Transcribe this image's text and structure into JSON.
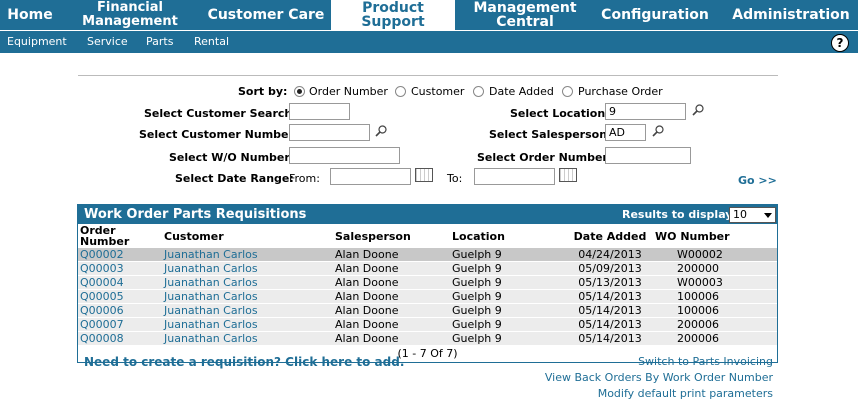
{
  "nav": {
    "items": [
      {
        "label": "Home"
      },
      {
        "label": "Financial Management"
      },
      {
        "label": "Customer Care"
      },
      {
        "label": "Product Support"
      },
      {
        "label": "Management Central"
      },
      {
        "label": "Configuration"
      },
      {
        "label": "Administration"
      }
    ],
    "active": "Product Support"
  },
  "subnav": {
    "items": [
      "Equipment",
      "Service",
      "Parts",
      "Rental"
    ],
    "help": "?"
  },
  "search": {
    "sort_by_label": "Sort by:",
    "sort_options": [
      "Order Number",
      "Customer",
      "Date Added",
      "Purchase Order"
    ],
    "sort_selected": "Order Number",
    "customer_search_label": "Select Customer Search:",
    "customer_search_value": "",
    "location_label": "Select Location:",
    "location_value": "9",
    "customer_number_label": "Select Customer Number:",
    "customer_number_value": "",
    "salesperson_label": "Select Salesperson:",
    "salesperson_value": "AD",
    "wo_number_label": "Select W/O Number:",
    "wo_number_value": "",
    "order_number_label": "Select Order Number:",
    "order_number_value": "",
    "date_range_label": "Select Date Range:",
    "from_label": "From:",
    "from_value": "",
    "to_label": "To:",
    "to_value": "",
    "go": "Go >>"
  },
  "grid": {
    "title": "Work Order Parts Requisitions",
    "results_label": "Results to display:",
    "results_value": "10",
    "columns": [
      "Order Number",
      "Customer",
      "Salesperson",
      "Location",
      "Date Added",
      "WO Number"
    ],
    "rows": [
      {
        "order": "Q00002",
        "customer": "Juanathan Carlos",
        "salesperson": "Alan Doone",
        "location": "Guelph 9",
        "date": "04/24/2013",
        "wo": "W00002"
      },
      {
        "order": "Q00003",
        "customer": "Juanathan Carlos",
        "salesperson": "Alan Doone",
        "location": "Guelph 9",
        "date": "05/09/2013",
        "wo": "200000"
      },
      {
        "order": "Q00004",
        "customer": "Juanathan Carlos",
        "salesperson": "Alan Doone",
        "location": "Guelph 9",
        "date": "05/13/2013",
        "wo": "W00003"
      },
      {
        "order": "Q00005",
        "customer": "Juanathan Carlos",
        "salesperson": "Alan Doone",
        "location": "Guelph 9",
        "date": "05/14/2013",
        "wo": "100006"
      },
      {
        "order": "Q00006",
        "customer": "Juanathan Carlos",
        "salesperson": "Alan Doone",
        "location": "Guelph 9",
        "date": "05/14/2013",
        "wo": "100006"
      },
      {
        "order": "Q00007",
        "customer": "Juanathan Carlos",
        "salesperson": "Alan Doone",
        "location": "Guelph 9",
        "date": "05/14/2013",
        "wo": "200006"
      },
      {
        "order": "Q00008",
        "customer": "Juanathan Carlos",
        "salesperson": "Alan Doone",
        "location": "Guelph 9",
        "date": "05/14/2013",
        "wo": "200006"
      }
    ],
    "pager": "(1 - 7 Of 7)"
  },
  "footer": {
    "need_requisition": "Need to create a requisition? Click here to add.",
    "links": [
      "Switch to Parts Invoicing",
      "View Back Orders By Work Order Number",
      "Modify default print parameters"
    ]
  },
  "colors": {
    "brand": "#1f6e96",
    "row": "#ececec",
    "row_selected": "#c8c8c8"
  }
}
